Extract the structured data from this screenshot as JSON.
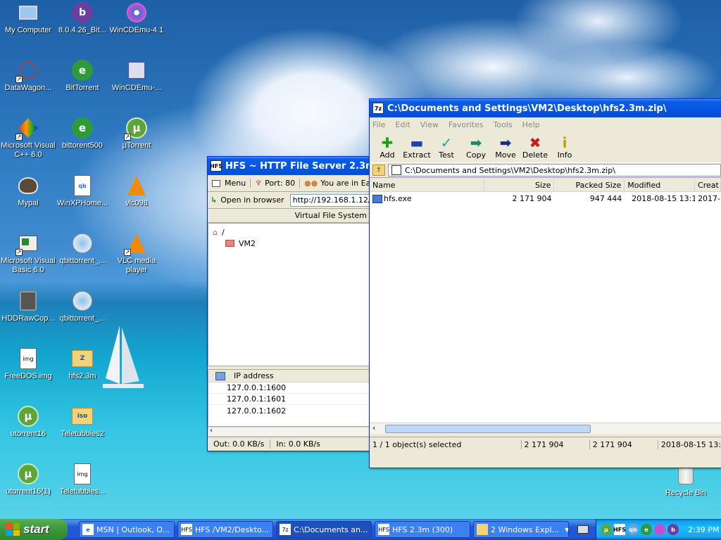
{
  "desktop": {
    "icons": [
      {
        "label": "My Computer",
        "icon": "computer-icon"
      },
      {
        "label": "8.0.4.26_Bit...",
        "icon": "bittorrent-installer-icon"
      },
      {
        "label": "WinCDEmu-4.1",
        "icon": "wincdemu-icon"
      },
      {
        "label": "DataWagon...",
        "icon": "datawagon-icon"
      },
      {
        "label": "BitTorrent",
        "icon": "bittorrent-icon"
      },
      {
        "label": "WinCDEmu-...",
        "icon": "wincdemu-installer-icon"
      },
      {
        "label": "Microsoft Visual C++ 6.0",
        "icon": "visual-cpp-icon"
      },
      {
        "label": "bittorent500",
        "icon": "bittorrent-icon"
      },
      {
        "label": "µTorrent",
        "icon": "utorrent-icon"
      },
      {
        "label": "Mypal",
        "icon": "mypal-icon"
      },
      {
        "label": "WinXPHome...",
        "icon": "qbittorrent-file-icon"
      },
      {
        "label": "vlc098",
        "icon": "vlc-icon"
      },
      {
        "label": "Microsoft Visual Basic 6.0",
        "icon": "visual-basic-icon"
      },
      {
        "label": "qbittorrent_...",
        "icon": "qbittorrent-installer-icon"
      },
      {
        "label": "VLC media player",
        "icon": "vlc-icon"
      },
      {
        "label": "HDDRawCop...",
        "icon": "hdd-icon"
      },
      {
        "label": "qbittorrent_...",
        "icon": "qbittorrent-installer-icon"
      },
      {
        "label": "FreeDOS.img",
        "icon": "disk-image-icon"
      },
      {
        "label": "hfs2.3m",
        "icon": "zip-folder-icon"
      },
      {
        "label": "utorrent16",
        "icon": "utorrent-icon"
      },
      {
        "label": "Teletubbies2",
        "icon": "iso-folder-icon"
      },
      {
        "label": "utorrent16(1)",
        "icon": "utorrent-icon"
      },
      {
        "label": "Teletubbies...",
        "icon": "file-icon"
      },
      {
        "label": "Recycle Bin",
        "icon": "recycle-bin-icon"
      }
    ],
    "glyphs": {
      "mini_s": "Z",
      "mini_iso": "iso",
      "mini_img": "img",
      "mini_qb": "qb",
      "mini_hfs": "HFS",
      "mini_7z": "7z",
      "utor": "µ",
      "bt": "b",
      "green": "e",
      "ut": "µ"
    }
  },
  "hfs": {
    "title": "HFS ~ HTTP File Server 2.3m",
    "menu": "Menu",
    "port": "Port: 80",
    "you_are_in": "You are in Ea",
    "open_browser": "Open in browser",
    "url": "http://192.168.1.12/",
    "vfs_header": "Virtual File System",
    "root": "/",
    "folder": "VM2",
    "ip_header": "IP address",
    "ips": [
      "127.0.0.1:1600",
      "127.0.0.1:1601",
      "127.0.0.1:1602"
    ],
    "out": "Out: 0.0 KB/s",
    "in": "In: 0.0 KB/s"
  },
  "zip": {
    "title": "C:\\Documents and Settings\\VM2\\Desktop\\hfs2.3m.zip\\",
    "menus": [
      "File",
      "Edit",
      "View",
      "Favorites",
      "Tools",
      "Help"
    ],
    "tools": [
      {
        "label": "Add",
        "glyph": "✚",
        "color": "#1ea01e"
      },
      {
        "label": "Extract",
        "glyph": "▬",
        "color": "#1a3fb8"
      },
      {
        "label": "Test",
        "glyph": "✓",
        "color": "#18a6a6"
      },
      {
        "label": "Copy",
        "glyph": "➡",
        "color": "#1c8a6a"
      },
      {
        "label": "Move",
        "glyph": "➡",
        "color": "#182a9a"
      },
      {
        "label": "Delete",
        "glyph": "✖",
        "color": "#d01818"
      },
      {
        "label": "Info",
        "glyph": "i",
        "color": "#c8a000"
      }
    ],
    "address": "C:\\Documents and Settings\\VM2\\Desktop\\hfs2.3m.zip\\",
    "columns": [
      "Name",
      "Size",
      "Packed Size",
      "Modified",
      "Creat"
    ],
    "files": [
      {
        "name": "hfs.exe",
        "size": "2 171 904",
        "packed": "947 444",
        "modified": "2018-08-15 13:14",
        "created": "2017-"
      }
    ],
    "status": {
      "selected": "1 / 1 object(s) selected",
      "size": "2 171 904",
      "packed": "2 171 904",
      "modified": "2018-08-15 13:"
    }
  },
  "taskbar": {
    "start": "start",
    "tasks": [
      {
        "label": "MSN | Outlook, O...",
        "icon": "ie-icon"
      },
      {
        "label": "HFS /VM2/Deskto...",
        "icon": "hfs-icon"
      },
      {
        "label": "C:\\Documents an...",
        "icon": "7zip-icon"
      },
      {
        "label": "HFS 2.3m (300)",
        "icon": "hfs-icon"
      },
      {
        "label": "2 Windows Expl...",
        "icon": "folder-icon"
      }
    ],
    "clock": "2:39 PM"
  }
}
